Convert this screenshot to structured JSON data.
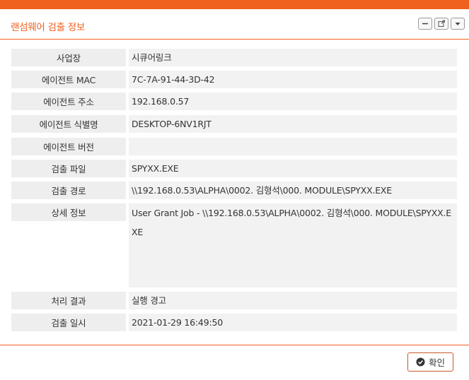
{
  "dialog": {
    "title": "랜섬웨어 검출 정보",
    "controls": [
      "minimize-icon",
      "popout-icon",
      "dropdown-icon"
    ]
  },
  "rows": [
    {
      "label": "사업장",
      "value": "시큐어링크"
    },
    {
      "label": "에이전트 MAC",
      "value": "7C-7A-91-44-3D-42"
    },
    {
      "label": "에이전트 주소",
      "value": "192.168.0.57"
    },
    {
      "label": "에이전트 식별명",
      "value": "DESKTOP-6NV1RJT"
    },
    {
      "label": "에이전트 버전",
      "value": ""
    },
    {
      "label": "검출 파일",
      "value": "SPYXX.EXE"
    },
    {
      "label": "검출 경로",
      "value": "\\\\192.168.0.53\\ALPHA\\0002. 김형석\\000. MODULE\\SPYXX.EXE"
    },
    {
      "label": "상세 정보",
      "value": "User Grant Job - \\\\192.168.0.53\\ALPHA\\0002. 김형석\\000. MODULE\\SPYXX.EXE"
    },
    {
      "label": "처리 결과",
      "value": "실행 경고"
    },
    {
      "label": "검출 일시",
      "value": "2021-01-29 16:49:50"
    }
  ],
  "footer": {
    "confirm_label": "확인"
  },
  "colors": {
    "accent": "#f0601f",
    "label_bg": "#eeeeee",
    "value_bg": "#f2f2f2"
  }
}
